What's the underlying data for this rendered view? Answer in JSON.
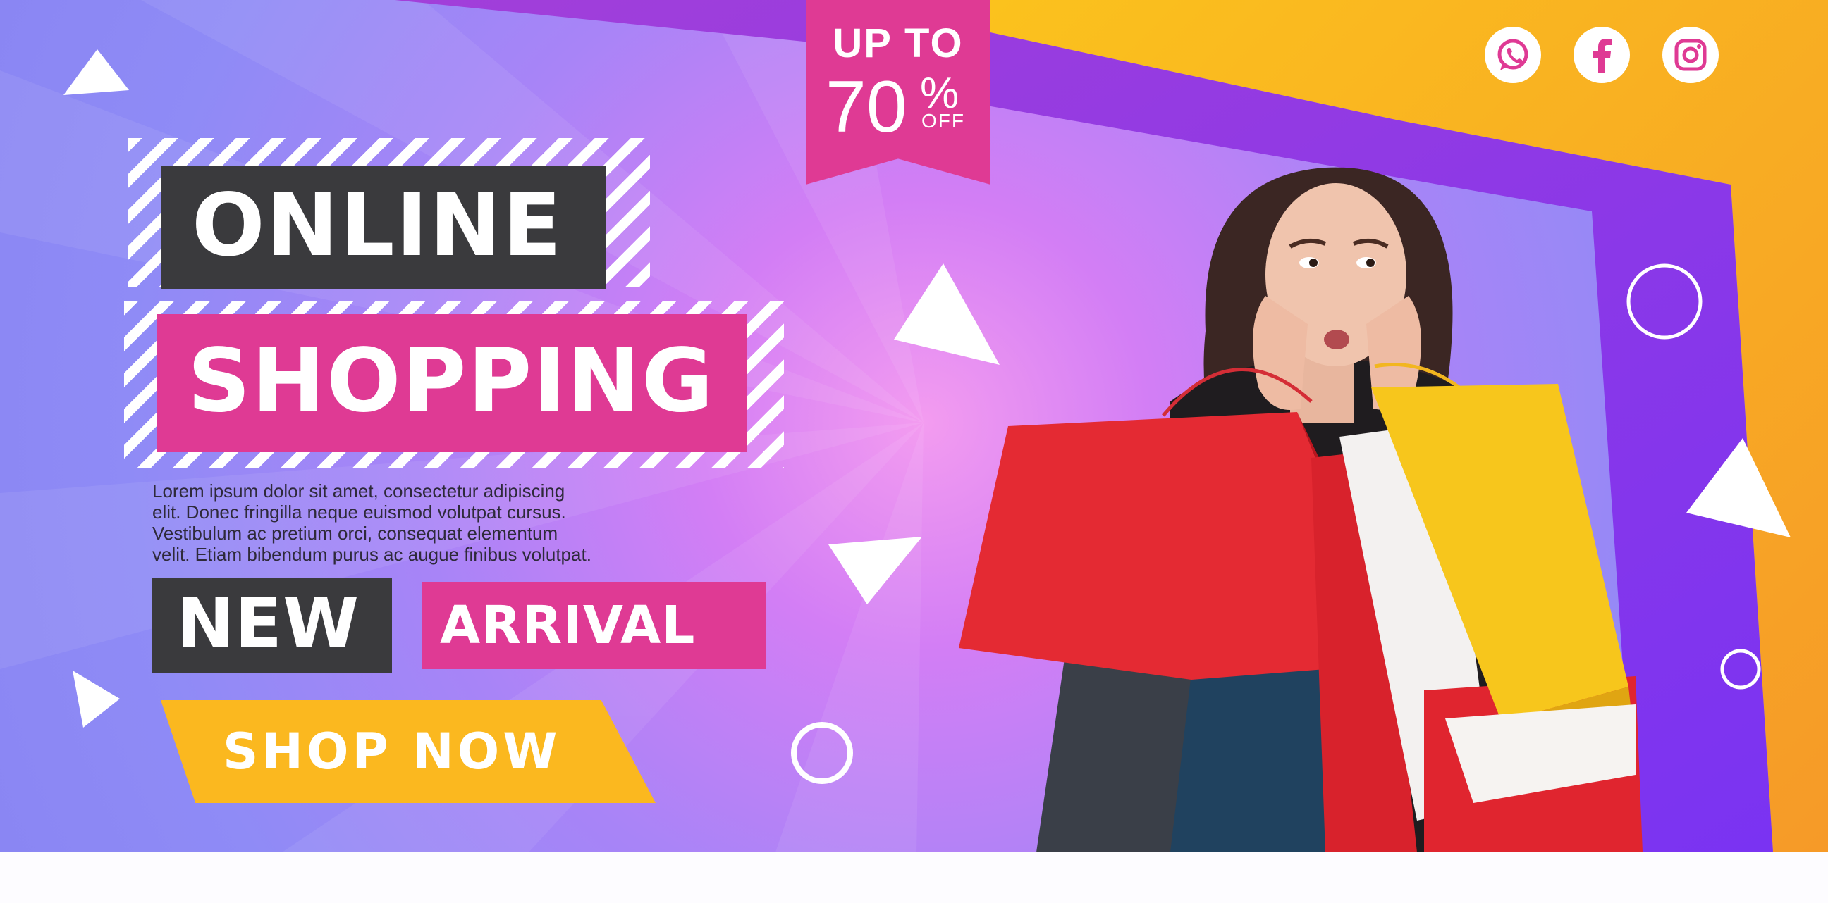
{
  "banner": {
    "headline_line1": "ONLINE",
    "headline_line2": "SHOPPING",
    "body_lines": [
      "Lorem ipsum dolor sit amet, consectetur adipiscing",
      "elit. Donec fringilla neque euismod volutpat cursus.",
      "Vestibulum ac pretium orci, consequat elementum",
      "velit. Etiam bibendum purus ac augue finibus volutpat."
    ],
    "tag_new": "NEW",
    "tag_arrival": "ARRIVAL",
    "cta_label": "SHOP NOW"
  },
  "discount": {
    "prefix": "UP TO",
    "value": "70",
    "percent": "%",
    "suffix": "OFF"
  },
  "social": {
    "icons": [
      "whatsapp-icon",
      "facebook-icon",
      "instagram-icon"
    ]
  },
  "colors": {
    "pink": "#df3a94",
    "dark": "#3a3a3d",
    "yellow": "#fbb81f",
    "purple": "#8a3cf0",
    "orange": "#f7a823"
  }
}
